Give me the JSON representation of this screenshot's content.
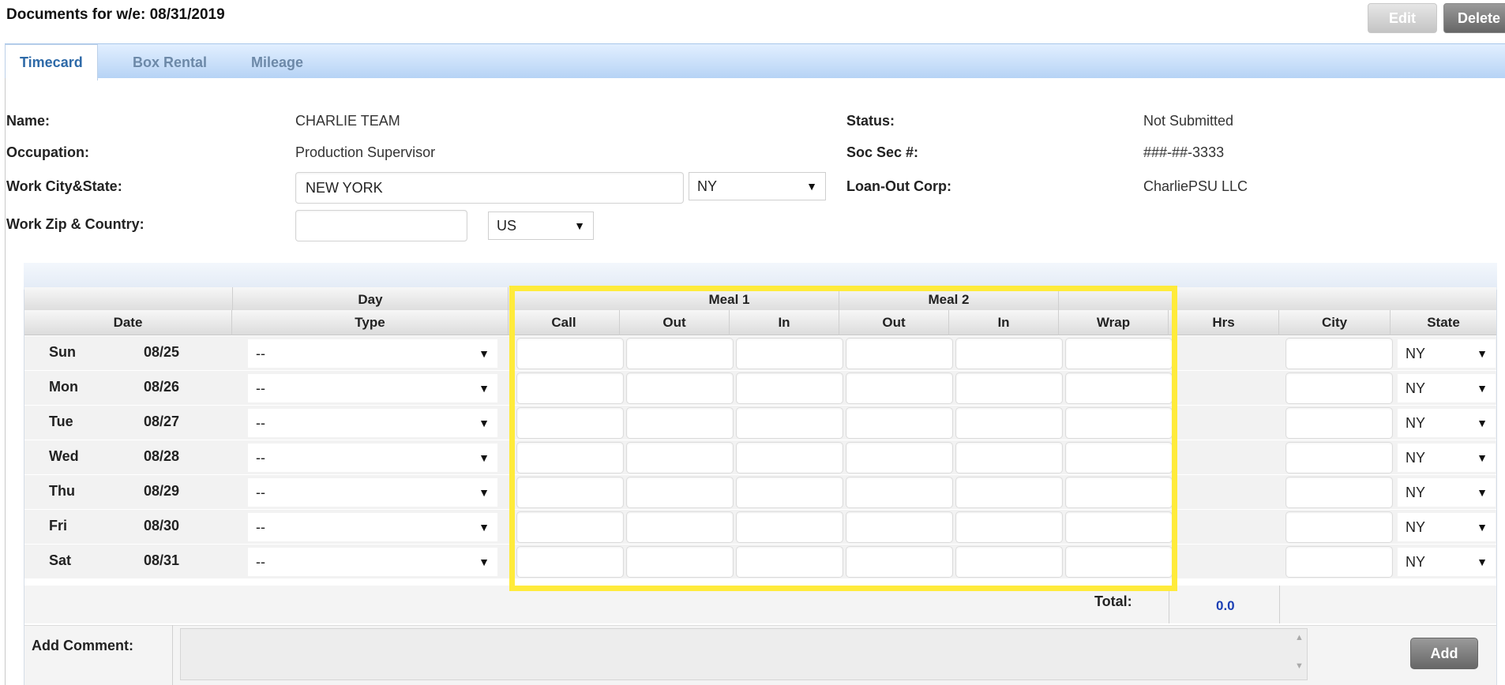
{
  "header": {
    "title": "Documents for w/e: 08/31/2019",
    "edit_label": "Edit",
    "delete_label": "Delete"
  },
  "tabs": [
    {
      "label": "Timecard",
      "active": true
    },
    {
      "label": "Box Rental",
      "active": false
    },
    {
      "label": "Mileage",
      "active": false
    }
  ],
  "info": {
    "name_label": "Name:",
    "name_value": "CHARLIE TEAM",
    "occupation_label": "Occupation:",
    "occupation_value": "Production Supervisor",
    "work_city_label": "Work City&State:",
    "work_city_value": "NEW YORK",
    "work_state_value": "NY",
    "work_zip_label": "Work Zip & Country:",
    "work_zip_value": "",
    "country_value": "US",
    "status_label": "Status:",
    "status_value": "Not Submitted",
    "ssn_label": "Soc Sec #:",
    "ssn_value": "###-##-3333",
    "loanout_label": "Loan-Out Corp:",
    "loanout_value": "CharliePSU LLC"
  },
  "grid": {
    "group_headers": {
      "day": "Day",
      "meal1": "Meal 1",
      "meal2": "Meal 2"
    },
    "columns": {
      "date": "Date",
      "type": "Type",
      "call": "Call",
      "meal1_out": "Out",
      "meal1_in": "In",
      "meal2_out": "Out",
      "meal2_in": "In",
      "wrap": "Wrap",
      "hrs": "Hrs",
      "city": "City",
      "state": "State"
    },
    "rows": [
      {
        "day": "Sun",
        "date": "08/25",
        "type": "--",
        "state": "NY"
      },
      {
        "day": "Mon",
        "date": "08/26",
        "type": "--",
        "state": "NY"
      },
      {
        "day": "Tue",
        "date": "08/27",
        "type": "--",
        "state": "NY"
      },
      {
        "day": "Wed",
        "date": "08/28",
        "type": "--",
        "state": "NY"
      },
      {
        "day": "Thu",
        "date": "08/29",
        "type": "--",
        "state": "NY"
      },
      {
        "day": "Fri",
        "date": "08/30",
        "type": "--",
        "state": "NY"
      },
      {
        "day": "Sat",
        "date": "08/31",
        "type": "--",
        "state": "NY"
      }
    ],
    "total_label": "Total:",
    "total_value": "0.0"
  },
  "comment": {
    "label": "Add Comment:",
    "value": "",
    "add_label": "Add"
  },
  "colors": {
    "highlight": "#ffeb3b",
    "tab_active": "#2e6aa8",
    "total_value": "#1a3fb4"
  }
}
